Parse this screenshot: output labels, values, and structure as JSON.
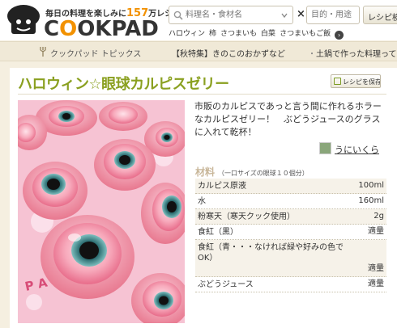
{
  "header": {
    "tagline_pre": "毎日の料理を楽しみに",
    "tagline_num": "157",
    "tagline_post": "万レシピ",
    "brand_c": "C",
    "brand_o": "O",
    "brand_rest": "OKPAD",
    "search_placeholder": "料理名・食材名",
    "search_times": "×",
    "search2_placeholder": "目的・用途",
    "search_button": "レシピ検",
    "keywords": [
      "ハロウィン",
      "柿",
      "さつまいも",
      "白菜",
      "さつまいもご飯"
    ]
  },
  "topics": {
    "label": "クックパッド トピックス",
    "item1": "【秋特集】きのこのおかずなど",
    "dot": "・",
    "item2": "土鍋で作った料理ってお"
  },
  "recipe": {
    "title": "ハロウィン☆眼球カルピスゼリー",
    "save_label": "レシピを保存",
    "description": "市販のカルピスであっと言う間に作れるホラーなカルピスゼリー！　ぶどうジュースのグラスに入れて乾杯！",
    "author": "うにいくら",
    "ingredients_heading": "材料",
    "ingredients_serving": "（一口サイズの眼球１０個分）",
    "ingredients": [
      {
        "name": "カルピス原液",
        "qty": "100ml"
      },
      {
        "name": "水",
        "qty": "160ml"
      },
      {
        "name": "粉寒天（寒天クック使用）",
        "qty": "2g"
      },
      {
        "name": "食紅（黒）",
        "qty": "適量"
      },
      {
        "name": "食紅（青・・・なければ緑や好みの色でOK）",
        "qty": "適量"
      },
      {
        "name": "ぶどうジュース",
        "qty": "適量"
      }
    ]
  },
  "colors": {
    "accent_orange": "#f29100",
    "title_green": "#8aa020",
    "background": "#f5efe0"
  }
}
